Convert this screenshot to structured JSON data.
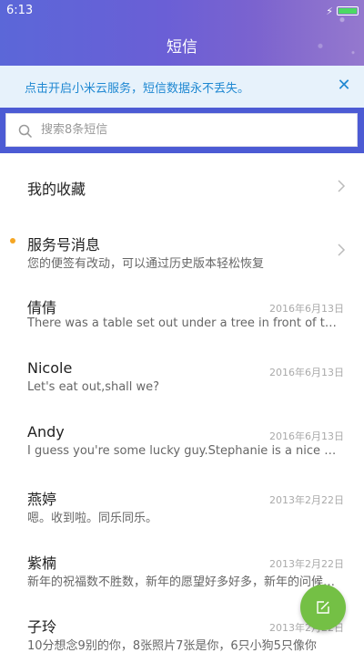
{
  "status_bar": {
    "time": "6:13",
    "battery_level": 1.0
  },
  "header": {
    "title": "短信"
  },
  "banner": {
    "text": "点击开启小米云服务，短信数据永不丢失。",
    "close_icon": "close-icon"
  },
  "search": {
    "placeholder": "搜索8条短信",
    "icon": "search-icon"
  },
  "favorites": {
    "label": "我的收藏"
  },
  "service": {
    "title": "服务号消息",
    "subtitle": "您的便签有改动，可以通过历史版本轻松恢复",
    "unread": true
  },
  "conversations": [
    {
      "name": "倩倩",
      "preview": "There was a table set out under a tree in front of the house...",
      "date": "2016年6月13日"
    },
    {
      "name": "Nicole",
      "preview": "Let's eat out,shall we?",
      "date": "2016年6月13日"
    },
    {
      "name": "Andy",
      "preview": "I guess you're some lucky guy.Stephanie is a nice girl.",
      "date": "2016年6月13日"
    },
    {
      "name": "燕婷",
      "preview": "嗯。收到啦。同乐同乐。",
      "date": "2013年2月22日"
    },
    {
      "name": "紫楠",
      "preview": "新年的祝福数不胜数，新年的愿望好多好多，新年的问候一定很多",
      "date": "2013年2月22日"
    },
    {
      "name": "子玲",
      "preview": "10分想念9别的你，8张照片7张是你，6只小狗5只像你",
      "date": "2013年2月22日"
    }
  ],
  "colors": {
    "accent": "#4c5bd4",
    "banner_text": "#1f88d2",
    "fab": "#74c045",
    "unread_dot": "#f5a623"
  },
  "fab": {
    "icon": "compose-icon"
  }
}
